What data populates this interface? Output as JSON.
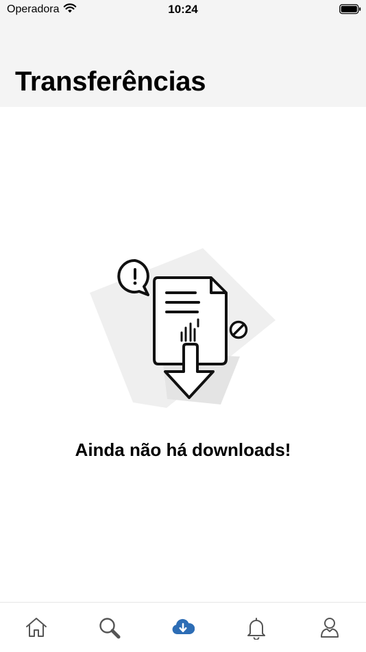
{
  "status_bar": {
    "carrier": "Operadora",
    "time": "10:24"
  },
  "header": {
    "title": "Transferências"
  },
  "empty_state": {
    "message": "Ainda não há downloads!"
  },
  "tab_bar": {
    "active_color": "#2d6db5",
    "inactive_color": "#555555",
    "tabs": [
      {
        "icon": "home-icon",
        "active": false
      },
      {
        "icon": "search-icon",
        "active": false
      },
      {
        "icon": "cloud-download-icon",
        "active": true
      },
      {
        "icon": "bell-icon",
        "active": false
      },
      {
        "icon": "user-icon",
        "active": false
      }
    ]
  }
}
